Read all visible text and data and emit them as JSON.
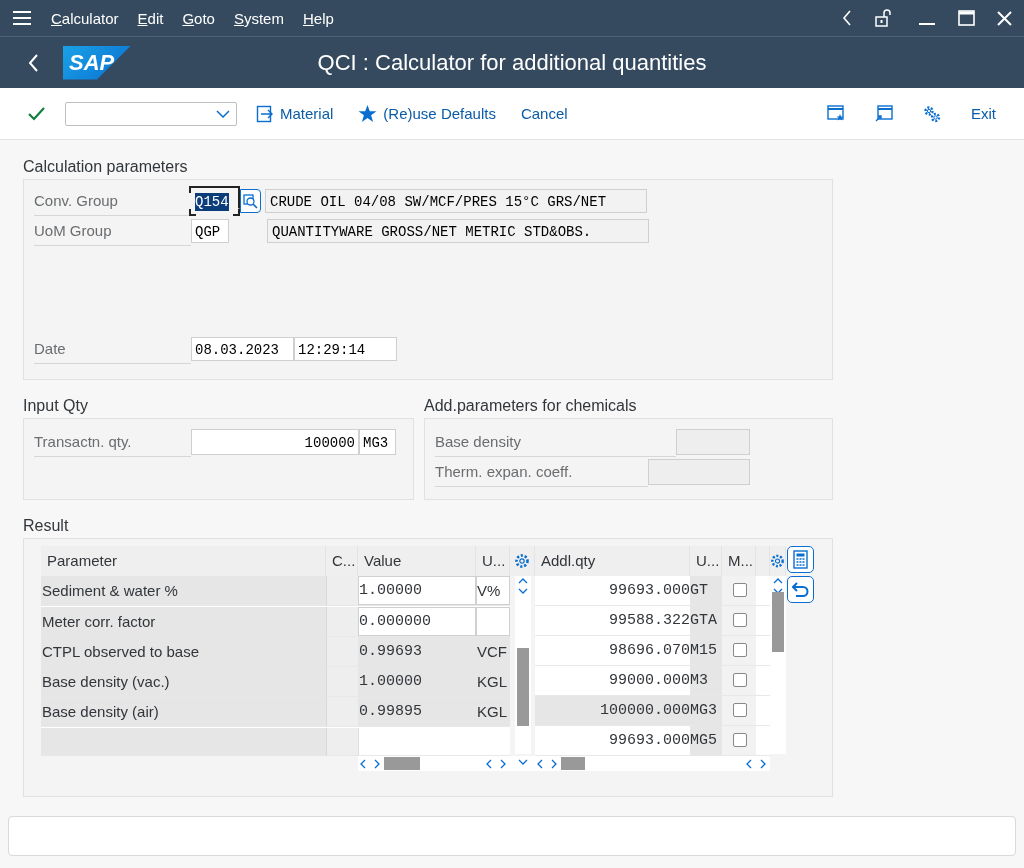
{
  "menu_bar": {
    "items": [
      "Calculator",
      "Edit",
      "Goto",
      "System",
      "Help"
    ]
  },
  "title_bar": {
    "logo": "SAP",
    "title": "QCI : Calculator for additional quantities"
  },
  "toolbar": {
    "buttons": [
      {
        "label": "Material",
        "kind": "material"
      },
      {
        "label": "(Re)use Defaults",
        "kind": "star"
      },
      {
        "label": "Cancel",
        "kind": "plain"
      }
    ],
    "exit": "Exit"
  },
  "calculation_parameters": {
    "title": "Calculation parameters",
    "fields": [
      {
        "label": "Conv. Group",
        "values": [
          "Q154"
        ],
        "focused": true,
        "search_help": true,
        "description": "CRUDE OIL 04/08 SW/MCF/PRES 15°C GRS/NET"
      },
      {
        "label": "UoM Group",
        "values": [
          "QGP"
        ],
        "focused": false,
        "search_help": false,
        "description": "QUANTITYWARE GROSS/NET METRIC STD&OBS."
      },
      {
        "label": "Date",
        "values": [
          "08.03.2023",
          "12:29:14"
        ],
        "focused": false,
        "search_help": false
      }
    ]
  },
  "input_qty": {
    "title": "Input Qty",
    "fields": [
      {
        "label": "Transactn. qty.",
        "value": "100000",
        "unit": "MG3"
      }
    ]
  },
  "chemical_parameters": {
    "title": "Add.parameters for chemicals",
    "fields": [
      {
        "label": "Base density",
        "disabled": true
      },
      {
        "label": "Therm. expan. coeff.",
        "disabled": true
      }
    ]
  },
  "result": {
    "title": "Result",
    "parameter_table": {
      "columns": [
        "Parameter",
        "C...",
        "Value",
        "U..."
      ],
      "rows": [
        {
          "parameter": "Sediment & water %",
          "value": "1.00000",
          "unit": "V%",
          "editable": true
        },
        {
          "parameter": "Meter corr. factor",
          "value": "0.000000",
          "editable": true
        },
        {
          "parameter": "CTPL observed to base",
          "value": "0.99693",
          "unit": "VCF",
          "editable": false
        },
        {
          "parameter": "Base density (vac.)",
          "value": "1.00000",
          "unit": "KGL",
          "editable": false
        },
        {
          "parameter": "Base density (air)",
          "value": "0.99895",
          "unit": "KGL",
          "editable": false
        }
      ]
    },
    "quantity_table": {
      "columns": [
        "Addl.qty",
        "U...",
        "M..."
      ],
      "rows": [
        {
          "quantity": "99693.000",
          "unit": "GT",
          "checked": false,
          "highlighted": false
        },
        {
          "quantity": "99588.322",
          "unit": "GTA",
          "checked": false,
          "highlighted": false
        },
        {
          "quantity": "98696.070",
          "unit": "M15",
          "checked": false,
          "highlighted": false
        },
        {
          "quantity": "99000.000",
          "unit": "M3",
          "checked": false,
          "highlighted": false
        },
        {
          "quantity": "100000.000",
          "unit": "MG3",
          "checked": false,
          "highlighted": true
        },
        {
          "quantity": "99693.000",
          "unit": "MG5",
          "checked": false,
          "highlighted": false
        }
      ]
    }
  }
}
